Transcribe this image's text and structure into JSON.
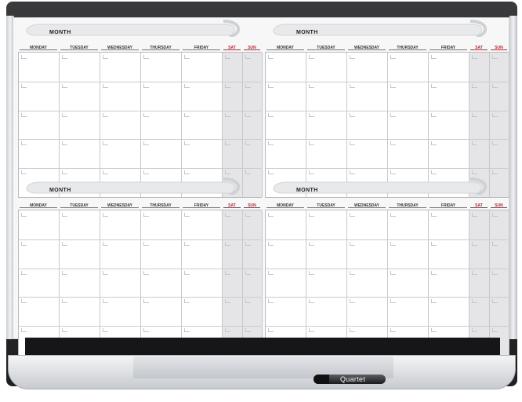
{
  "calendar": {
    "month_label": "MONTH",
    "days": [
      "MONDAY",
      "TUESDAY",
      "WEDNESDAY",
      "THURSDAY",
      "FRIDAY",
      "SAT",
      "SUN"
    ],
    "weeks_per_month": 5,
    "months_shown": 4
  },
  "tray": {
    "brand": "Quartet"
  },
  "colors": {
    "frame": "#2b2b2d",
    "board": "#f7f7f8",
    "weekend_fill": "#e5e5e7",
    "weekend_text": "#c52032",
    "aluminum": "#c7cacf"
  }
}
